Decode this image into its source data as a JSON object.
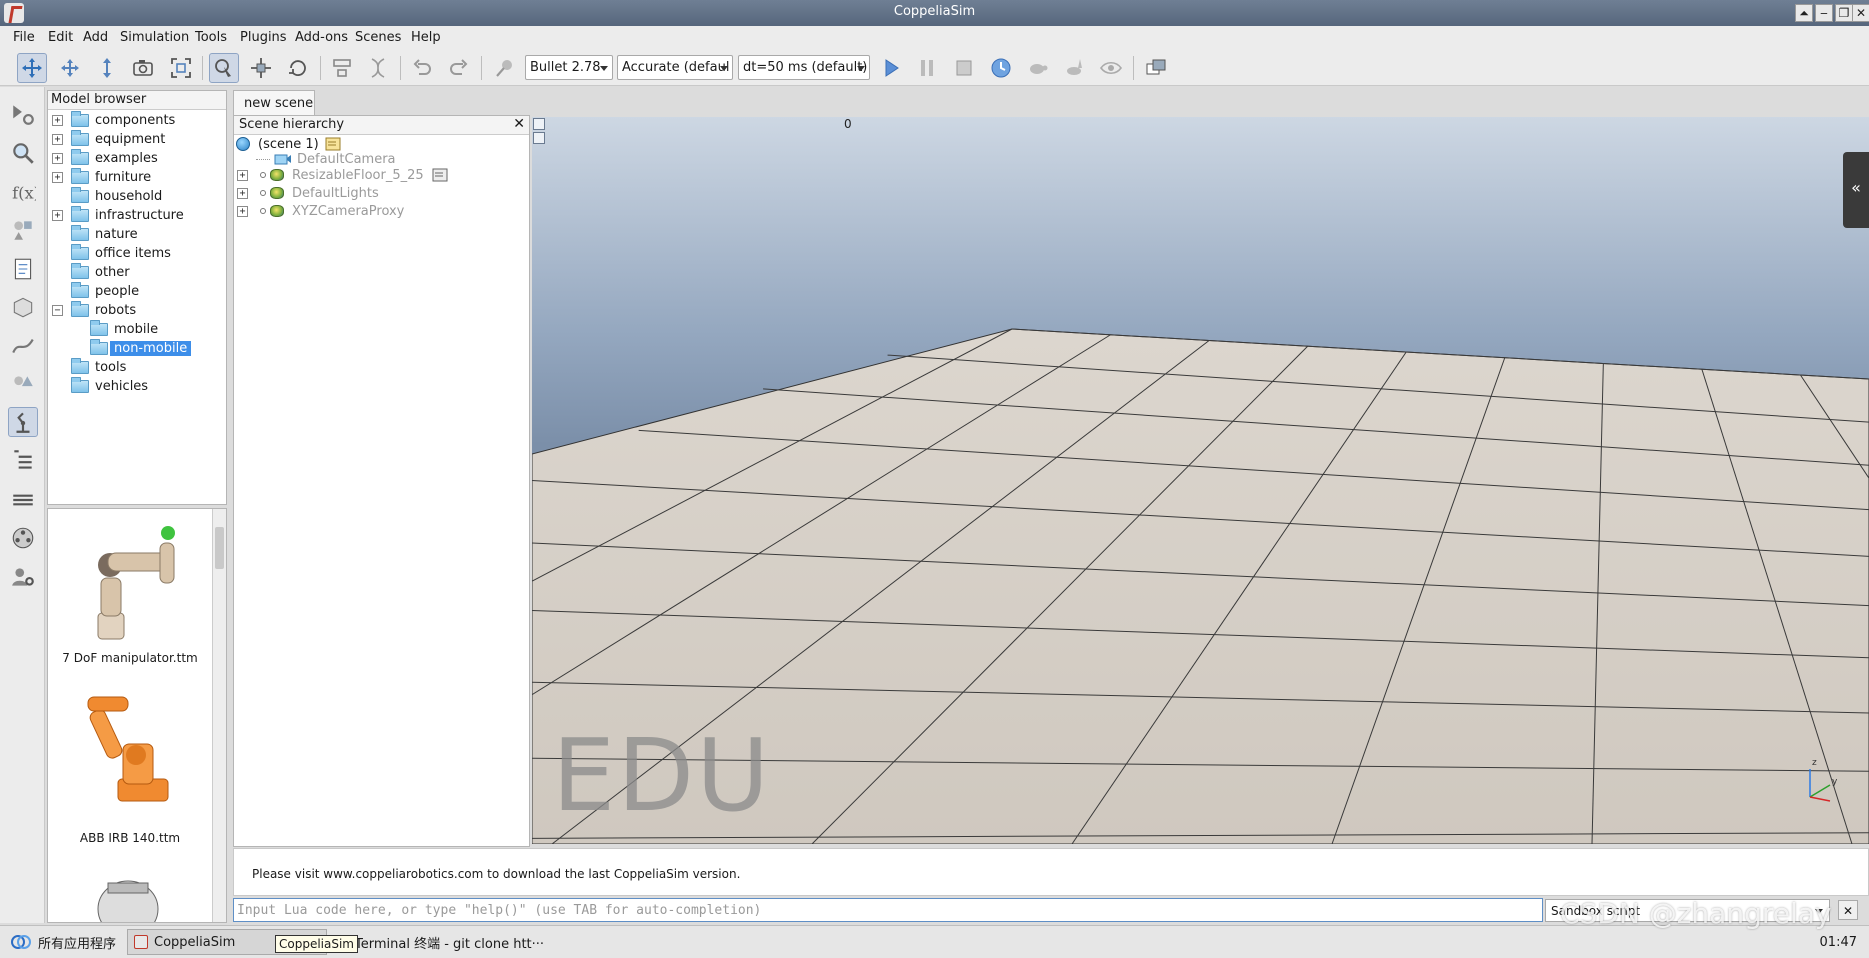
{
  "window": {
    "title": "CoppeliaSim"
  },
  "menu": [
    "File",
    "Edit",
    "Add",
    "Simulation",
    "Tools",
    "Plugins",
    "Add-ons",
    "Scenes",
    "Help"
  ],
  "toolbar": {
    "physics_engine": "Bullet 2.78",
    "accuracy": "Accurate (defaul",
    "timestep": "dt=50 ms (default)"
  },
  "model_browser": {
    "title": "Model browser",
    "folders": [
      {
        "label": "components",
        "expandable": true
      },
      {
        "label": "equipment",
        "expandable": true
      },
      {
        "label": "examples",
        "expandable": true
      },
      {
        "label": "furniture",
        "expandable": true
      },
      {
        "label": "household",
        "expandable": false
      },
      {
        "label": "infrastructure",
        "expandable": true
      },
      {
        "label": "nature",
        "expandable": false
      },
      {
        "label": "office items",
        "expandable": false
      },
      {
        "label": "other",
        "expandable": false
      },
      {
        "label": "people",
        "expandable": false
      },
      {
        "label": "robots",
        "expandable": true,
        "expanded": true
      },
      {
        "label": "mobile",
        "child": true
      },
      {
        "label": "non-mobile",
        "child": true,
        "selected": true
      },
      {
        "label": "tools",
        "expandable": false
      },
      {
        "label": "vehicles",
        "expandable": false
      }
    ],
    "thumbnails": [
      "7 DoF manipulator.ttm",
      "ABB IRB 140.ttm"
    ]
  },
  "scene_tab": "new scene",
  "hierarchy": {
    "title": "Scene hierarchy",
    "root": "(scene 1)",
    "objects": [
      "DefaultCamera",
      "ResizableFloor_5_25",
      "DefaultLights",
      "XYZCameraProxy"
    ]
  },
  "viewport": {
    "top_number": "0",
    "watermark": "EDU",
    "collapse_glyph": "«",
    "axes": {
      "y": "y",
      "z": "z"
    }
  },
  "status": {
    "message": "Please visit www.coppeliarobotics.com to download the last CoppeliaSim version."
  },
  "lua": {
    "placeholder": "Input Lua code here, or type \"help()\" (use TAB for auto-completion)",
    "script_selector": "Sandbox script"
  },
  "taskbar": {
    "start_label": "所有应用程序",
    "tasks": [
      "CoppeliaSim",
      "Terminal 终端 - git clone htt···"
    ],
    "tooltip": "CoppeliaSim",
    "clock": "01:47",
    "watermark": "CSDN @zhangrelay"
  },
  "colors": {
    "selection": "#3d8ee9",
    "titlebar": "#5f6f86"
  }
}
